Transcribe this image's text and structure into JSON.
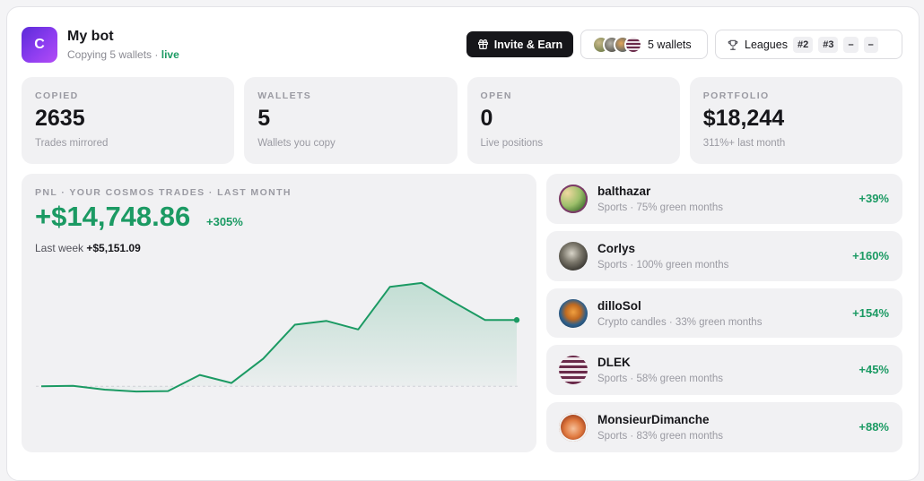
{
  "header": {
    "logo_letter": "C",
    "bot_name": "My bot",
    "subtitle": "Copying 5 wallets",
    "separator": "·",
    "status": "live",
    "invite_label": "Invite & Earn",
    "wallets_label": "5 wallets",
    "leagues_label": "Leagues",
    "league_pills": [
      "#2",
      "#3",
      "–",
      "–"
    ]
  },
  "stats": [
    {
      "label": "COPIED",
      "value": "2635",
      "sub": "Trades mirrored"
    },
    {
      "label": "WALLETS",
      "value": "5",
      "sub": "Wallets you copy"
    },
    {
      "label": "OPEN",
      "value": "0",
      "sub": "Live positions"
    },
    {
      "label": "PORTFOLIO",
      "value": "$18,244",
      "sub": "311%+ last month"
    }
  ],
  "pnl": {
    "label": "PNL · YOUR COSMOS TRADES · LAST MONTH",
    "value": "+$14,748.86",
    "pct": "+305%",
    "week_label": "Last week",
    "week_value": "+$5,151.09"
  },
  "chart_data": {
    "type": "area",
    "x": [
      0,
      1,
      2,
      3,
      4,
      5,
      6,
      7,
      8,
      9,
      10,
      11,
      12,
      13,
      14,
      15
    ],
    "values": [
      0,
      60,
      -350,
      -550,
      -500,
      1200,
      350,
      2900,
      6500,
      6900,
      6000,
      10500,
      10900,
      8900,
      7000,
      7000
    ],
    "ylim": [
      -1200,
      12500
    ],
    "color": "#1b9a63"
  },
  "wallets": [
    {
      "name": "balthazar",
      "sub": "Sports · 75% green months",
      "pct": "+39%"
    },
    {
      "name": "Corlys",
      "sub": "Sports · 100% green months",
      "pct": "+160%"
    },
    {
      "name": "dilloSol",
      "sub": "Crypto candles · 33% green months",
      "pct": "+154%"
    },
    {
      "name": "DLEK",
      "sub": "Sports · 58% green months",
      "pct": "+45%"
    },
    {
      "name": "MonsieurDimanche",
      "sub": "Sports · 83% green months",
      "pct": "+88%"
    }
  ],
  "colors": {
    "accent_green": "#1b9a63",
    "dark": "#16161a",
    "brand_purple": "#7a36e6"
  },
  "icons": {
    "invite": "gift-icon",
    "leagues": "trophy-icon"
  }
}
